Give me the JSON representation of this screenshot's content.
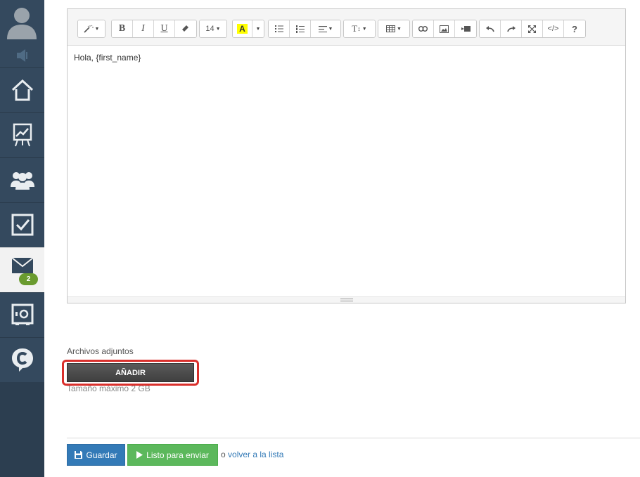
{
  "sidebar": {
    "items": [
      {
        "icon": "home-icon"
      },
      {
        "icon": "chart-board-icon"
      },
      {
        "icon": "users-icon"
      },
      {
        "icon": "checkbox-icon"
      },
      {
        "icon": "mail-icon",
        "badge": "2",
        "active": true
      },
      {
        "icon": "safe-icon"
      },
      {
        "icon": "chat-c-icon"
      }
    ]
  },
  "editor": {
    "toolbar": {
      "font_size": "14",
      "text_style_label": "T",
      "help_label": "?",
      "code_label": "</>",
      "bold_label": "B",
      "italic_label": "I",
      "underline_label": "U",
      "highlight_label": "A"
    },
    "content": "Hola, {first_name}"
  },
  "attachments": {
    "label": "Archivos adjuntos",
    "add_label": "AÑADIR",
    "max_size": "Tamaño máximo 2 GB"
  },
  "actions": {
    "save_label": "Guardar",
    "ready_label": "Listo para enviar",
    "back_prefix": "o",
    "back_link": "volver a la lista"
  },
  "colors": {
    "sidebar": "#34495e",
    "save": "#337ab7",
    "ready": "#5cb85c",
    "highlight_outline": "#d9302c",
    "badge": "#6a9b2f"
  }
}
